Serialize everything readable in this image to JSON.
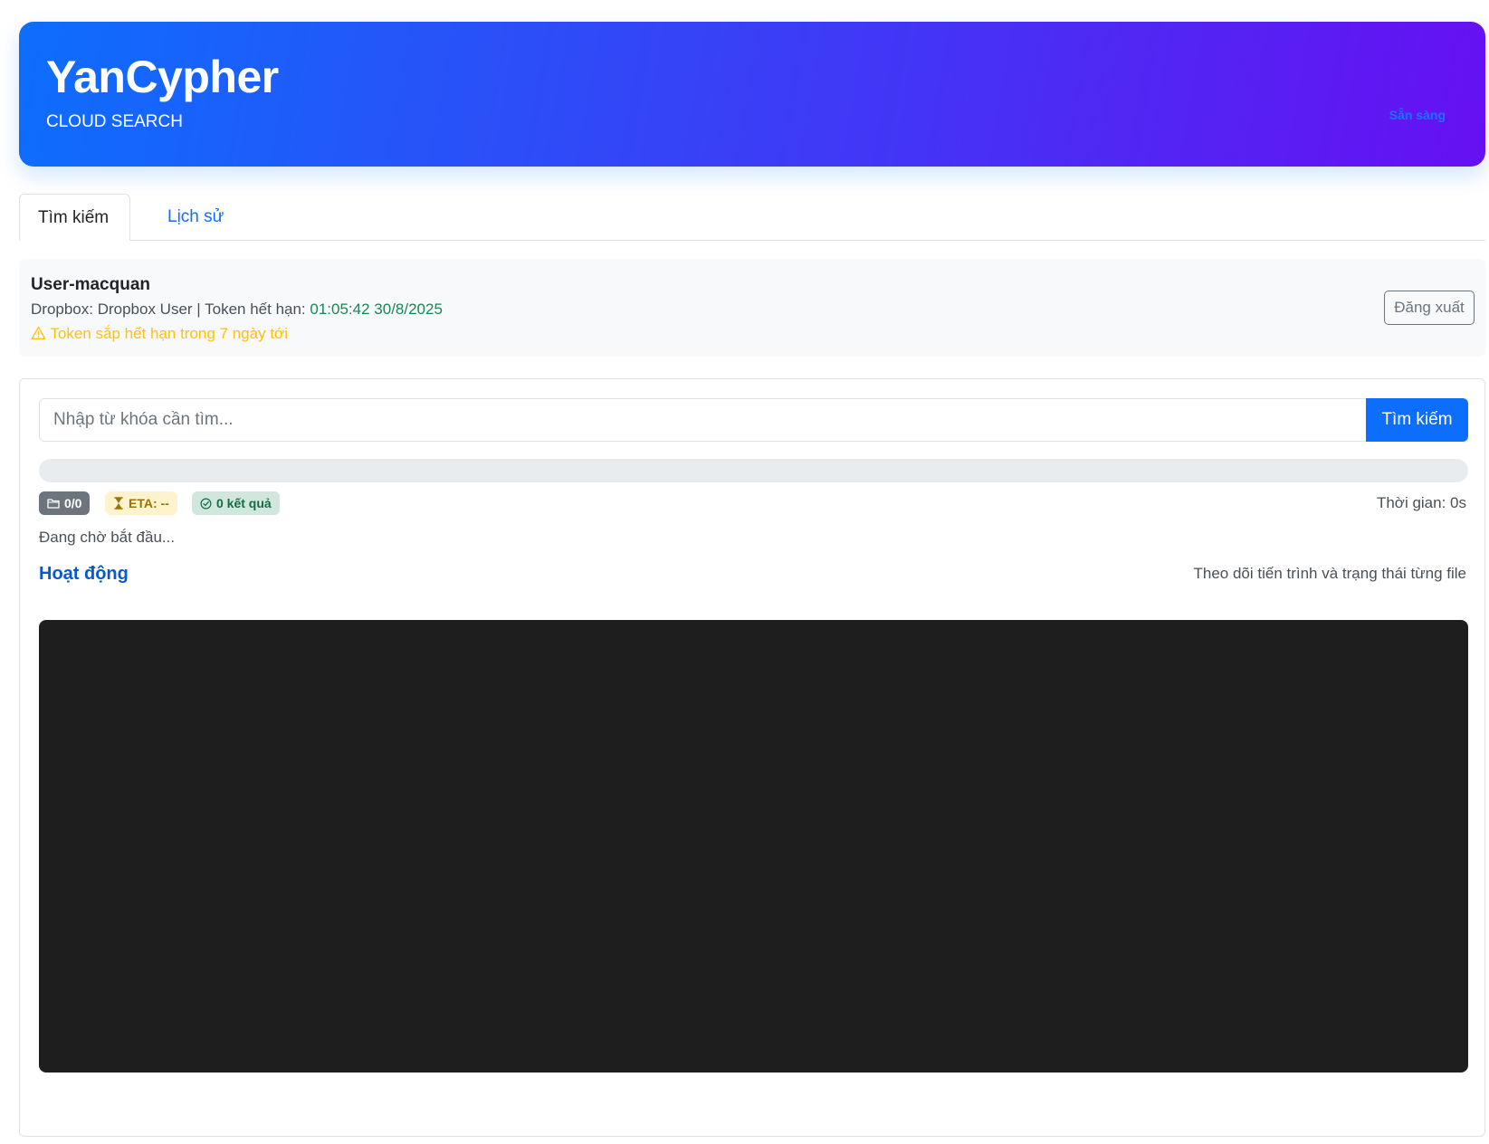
{
  "header": {
    "title": "YanCypher",
    "subtitle": "CLOUD SEARCH",
    "status": "Sẵn sàng"
  },
  "tabs": [
    {
      "label": "Tìm kiếm",
      "active": true
    },
    {
      "label": "Lịch sử",
      "active": false
    }
  ],
  "user": {
    "name": "User-macquan",
    "info_prefix": "Dropbox: Dropbox User | Token hết hạn: ",
    "expiry": "01:05:42 30/8/2025",
    "warning": "Token sắp hết hạn trong 7 ngày tới",
    "warning_icon": "warning-triangle-icon",
    "logout_label": "Đăng xuất"
  },
  "search": {
    "placeholder": "Nhập từ khóa cần tìm...",
    "value": "",
    "button_label": "Tìm kiếm",
    "progress_percent": 0
  },
  "stats": {
    "files": "0/0",
    "files_icon": "folder-icon",
    "eta": "ETA: --",
    "eta_icon": "hourglass-icon",
    "results": "0 kết quả",
    "results_icon": "check-circle-icon",
    "elapsed": "Thời gian: 0s"
  },
  "status_text": "Đang chờ bắt đầu...",
  "activity": {
    "title": "Hoạt động",
    "description": "Theo dõi tiến trình và trạng thái từng file"
  },
  "colors": {
    "primary": "#0d6efd",
    "gradient_end": "#6610f2",
    "success": "#198754",
    "warning": "#ffc107",
    "console_bg": "#1e1e1e"
  }
}
